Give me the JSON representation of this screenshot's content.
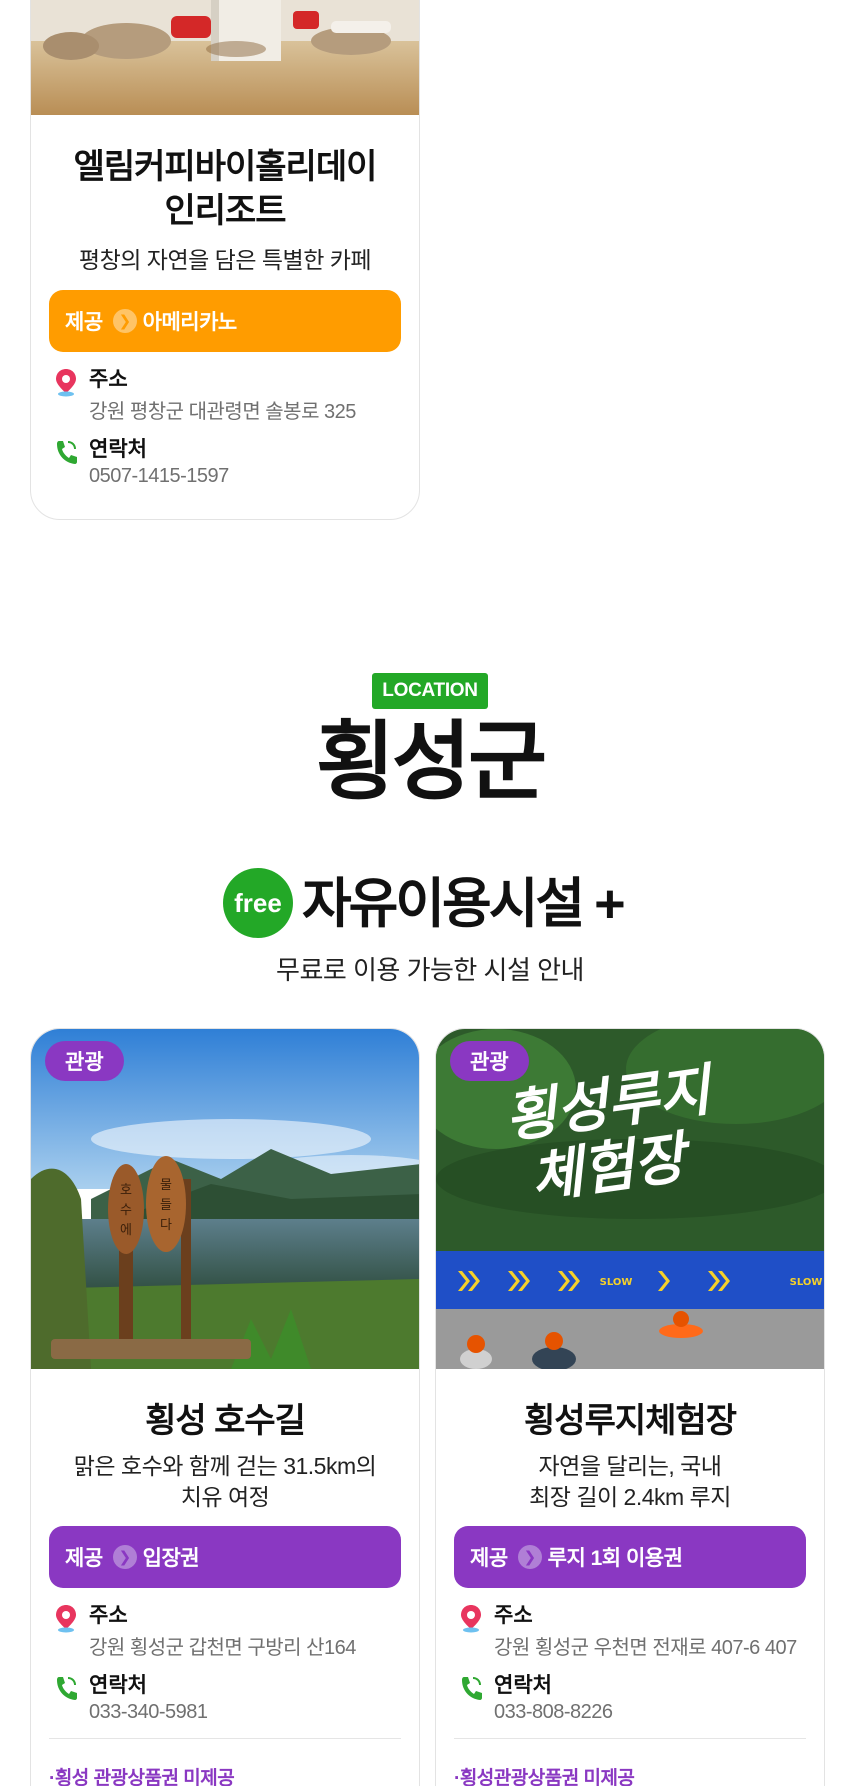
{
  "colors": {
    "orange": "#ff9c00",
    "purple": "#8a38c2",
    "green": "#23a827",
    "gray_text": "#707070"
  },
  "top_card": {
    "title_line1": "엘림커피바이홀리데이",
    "title_line2": "인리조트",
    "description": "평창의 자연을 담은 특별한 카페",
    "provide_label": "제공",
    "provide_value": "아메리카노",
    "address_label": "주소",
    "address_value": "강원 평창군 대관령면 솔봉로 325",
    "contact_label": "연락처",
    "contact_value": "0507-1415-1597"
  },
  "location": {
    "badge": "LOCATION",
    "region": "횡성군",
    "free_badge": "free",
    "free_title": "자유이용시설 +",
    "free_subtitle": "무료로 이용 가능한 시설 안내"
  },
  "cards": [
    {
      "tag": "관광",
      "title": "횡성 호수길",
      "desc_line1": "맑은 호수와 함께 걷는 31.5km의",
      "desc_line2": "치유 여정",
      "provide_label": "제공",
      "provide_value": "입장권",
      "address_label": "주소",
      "address_value": "강원 횡성군 갑천면 구방리 산164",
      "contact_label": "연락처",
      "contact_value": "033-340-5981",
      "note": "·횡성 관광상품권 미제공",
      "image_sign": "호수에 물들다"
    },
    {
      "tag": "관광",
      "title": "횡성루지체험장",
      "desc_line1": "자연을 달리는, 국내",
      "desc_line2": "최장 길이 2.4km 루지",
      "provide_label": "제공",
      "provide_value": "루지 1회 이용권",
      "address_label": "주소",
      "address_value": "강원 횡성군 우천면 전재로 407-6 407",
      "contact_label": "연락처",
      "contact_value": "033-808-8226",
      "note": "·횡성관광상품권 미제공",
      "image_title_line1": "횡성루지",
      "image_title_line2": "체험장",
      "image_banner": "SLOW"
    }
  ]
}
